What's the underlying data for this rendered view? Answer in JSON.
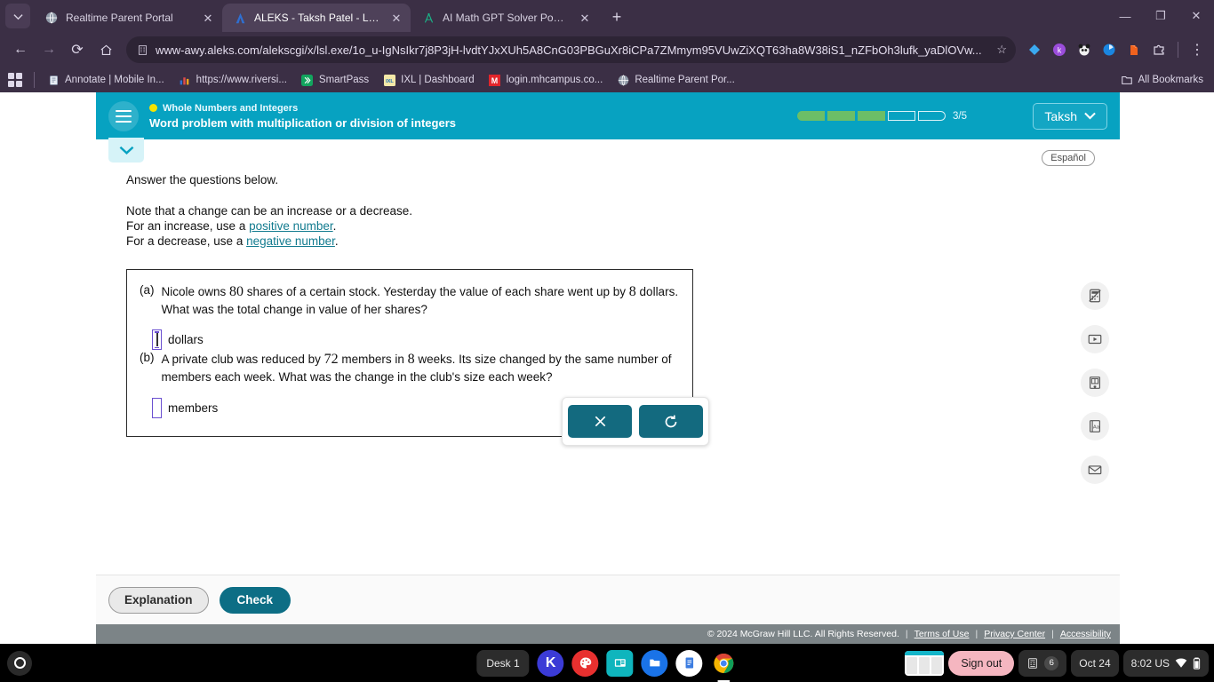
{
  "browser": {
    "tabs": [
      {
        "title": "Realtime Parent Portal",
        "favicon": "globe-icon",
        "active": false
      },
      {
        "title": "ALEKS - Taksh Patel - Learn",
        "favicon": "aleks-icon",
        "active": true
      },
      {
        "title": "AI Math GPT Solver Powered b",
        "favicon": "compass-icon",
        "active": false
      }
    ],
    "new_tab_label": "+",
    "window_controls": {
      "minimize": "—",
      "maximize": "❐",
      "close": "✕"
    },
    "nav": {
      "back": "←",
      "forward": "→",
      "reload": "⟳",
      "home": "⌂"
    },
    "url": "www-awy.aleks.com/alekscgi/x/lsl.exe/1o_u-IgNsIkr7j8P3jH-lvdtYJxXUh5A8CnG03PBGuXr8iCPa7ZMmym95VUwZiXQT63ha8W38iS1_nZFbOh3lufk_yaDlOVw...",
    "star": "☆",
    "extensions": [
      "diamond-extension-icon",
      "k-extension-icon",
      "panda-extension-icon",
      "clarity-extension-icon",
      "reader-extension-icon",
      "puzzle-extension-icon"
    ],
    "menu": "⋮",
    "bookmarks": [
      {
        "label": "Annotate | Mobile In...",
        "icon": "note-icon"
      },
      {
        "label": "https://www.riversi...",
        "icon": "chart-icon"
      },
      {
        "label": "SmartPass",
        "icon": "smartpass-icon"
      },
      {
        "label": "IXL | Dashboard",
        "icon": "ixl-icon"
      },
      {
        "label": "login.mhcampus.co...",
        "icon": "mcgraw-icon"
      },
      {
        "label": "Realtime Parent Por...",
        "icon": "globe-icon"
      }
    ],
    "all_bookmarks": "All Bookmarks",
    "all_bookmarks_icon": "folder-icon"
  },
  "aleks": {
    "menu_icon": "hamburger-icon",
    "topic": "Whole Numbers and Integers",
    "topic_dot_color": "#f6e400",
    "objective": "Word problem with multiplication or division of integers",
    "progress": {
      "total": 5,
      "filled": 3,
      "label": "3/5",
      "fill_color": "#6cbe67"
    },
    "user": {
      "name": "Taksh",
      "chevron": "⌄"
    },
    "collapse_icon": "chevron-down-icon",
    "espanol": "Español",
    "instructions": {
      "heading": "Answer the questions below.",
      "note_line1": "Note that a change can be an increase or a decrease.",
      "note_line2_pre": "For an increase, use a ",
      "note_link1": "positive number",
      "note_line2_post": ".",
      "note_line3_pre": "For a decrease, use a ",
      "note_link2": "negative number",
      "note_line3_post": "."
    },
    "questions": [
      {
        "label": "(a)",
        "text_1": "Nicole owns ",
        "num_1": "80",
        "text_2": " shares of a certain stock. Yesterday the value of each share went up by ",
        "num_2": "8",
        "text_3": " dollars. What was the total change in value of her shares?",
        "answer_value": "",
        "unit": "dollars",
        "focused": true
      },
      {
        "label": "(b)",
        "text_1": "A private club was reduced by ",
        "num_1": "72",
        "text_2": " members in ",
        "num_2": "8",
        "text_3": " weeks. Its size changed by the same number of members each week. What was the change in the club's size each week?",
        "answer_value": "",
        "unit": "members",
        "focused": false
      }
    ],
    "keypad": {
      "clear_label": "✕",
      "clear_name": "clear-icon",
      "undo_label": "↺",
      "undo_name": "undo-icon"
    },
    "tool_rail": [
      {
        "name": "calculator-disabled-icon"
      },
      {
        "name": "video-icon"
      },
      {
        "name": "book-icon"
      },
      {
        "name": "dictionary-icon"
      },
      {
        "name": "mail-icon"
      }
    ],
    "actions": {
      "explanation": "Explanation",
      "check": "Check"
    },
    "footer": {
      "copyright": "© 2024 McGraw Hill LLC. All Rights Reserved.",
      "links": [
        "Terms of Use",
        "Privacy Center",
        "Accessibility"
      ],
      "divider": "|"
    }
  },
  "shelf": {
    "launcher_icon": "launcher-icon",
    "desk": "Desk 1",
    "apps": [
      {
        "name": "khan-academy-icon",
        "label": "K"
      },
      {
        "name": "art-palette-icon",
        "label": ""
      },
      {
        "name": "presentation-icon",
        "label": ""
      },
      {
        "name": "files-icon",
        "label": ""
      },
      {
        "name": "docs-icon",
        "label": ""
      },
      {
        "name": "chrome-icon",
        "label": ""
      }
    ],
    "window_preview": "window-preview-icon",
    "sign_out": "Sign out",
    "tray_badge": "6",
    "tray_badge_icon": "calculator-tray-icon",
    "date": "Oct 24",
    "time": "8:02 US",
    "wifi_icon": "wifi-icon",
    "battery_icon": "battery-icon"
  }
}
